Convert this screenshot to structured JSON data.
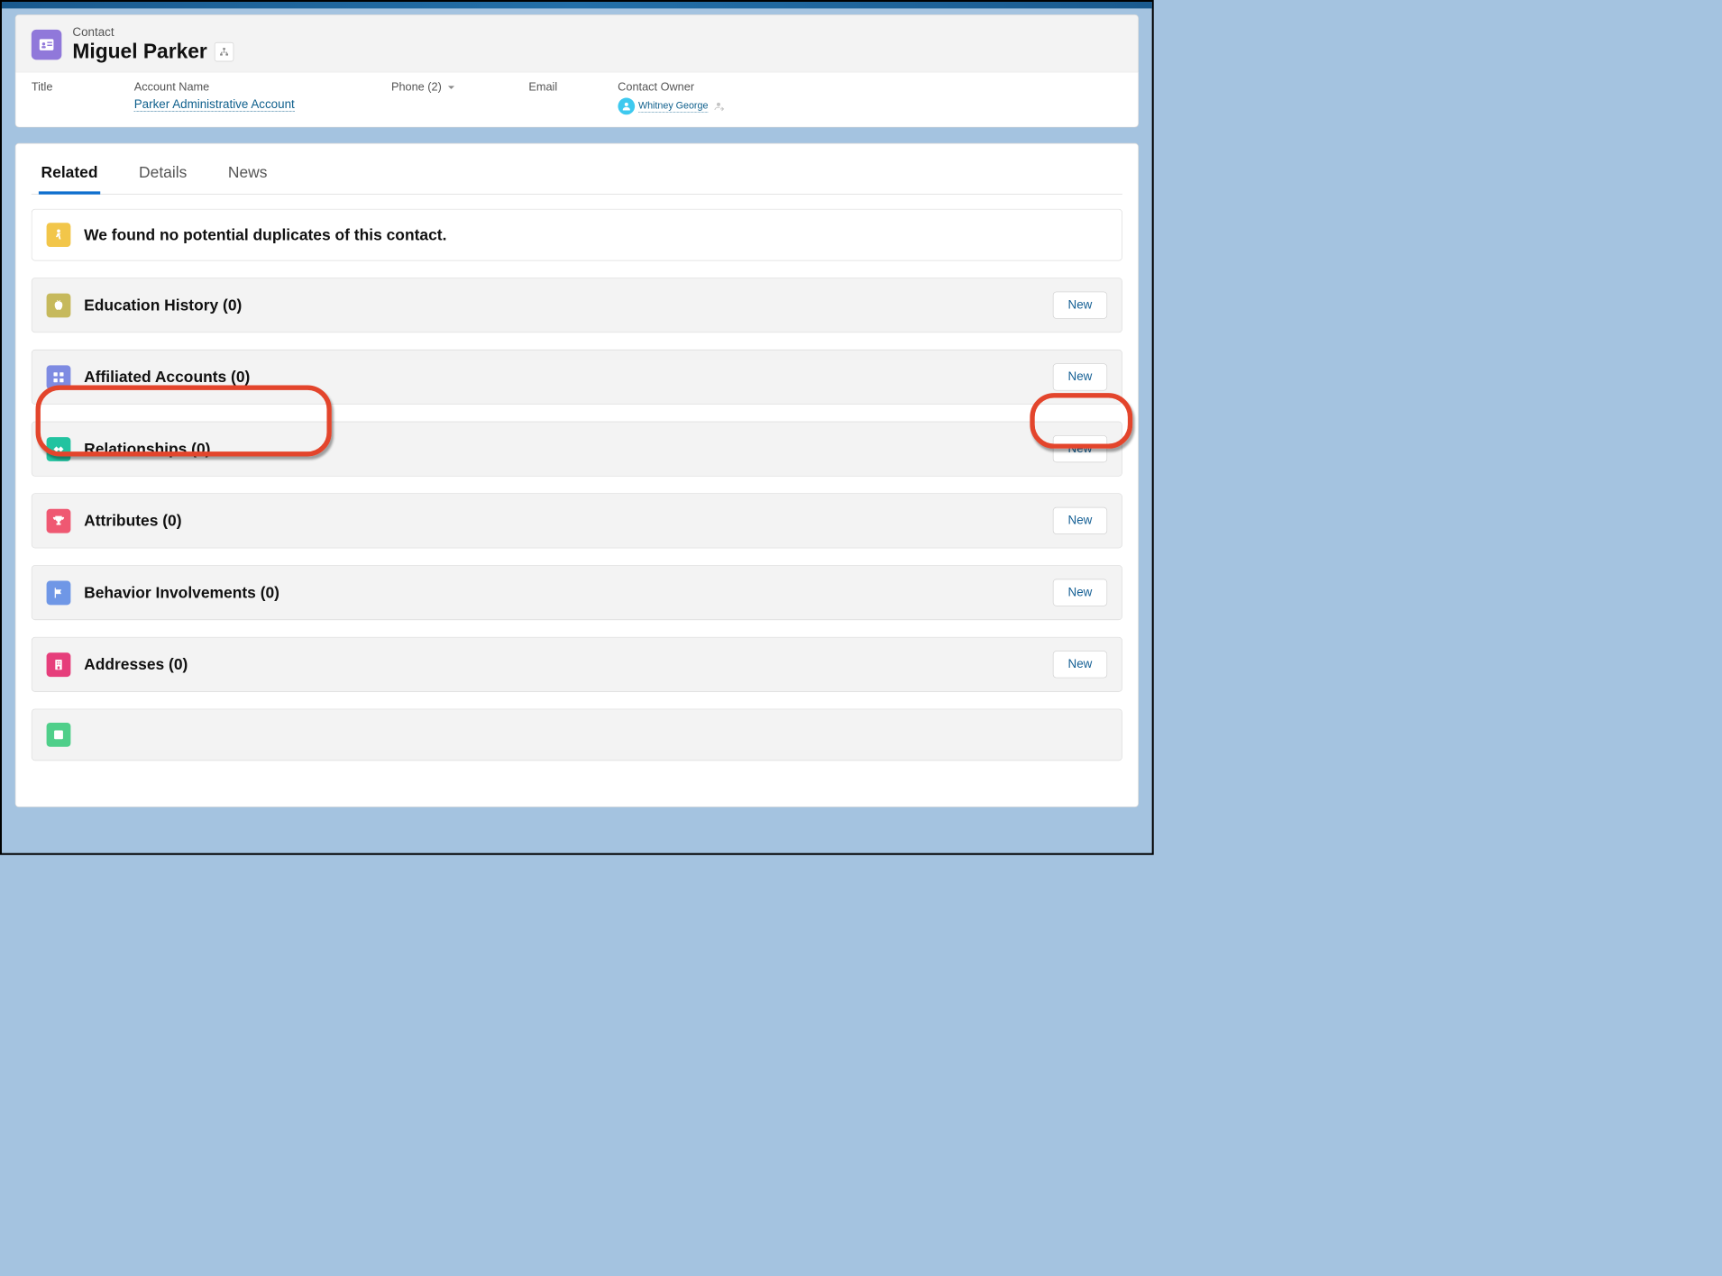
{
  "header": {
    "object_label": "Contact",
    "contact_name": "Miguel Parker"
  },
  "fields": {
    "title_label": "Title",
    "account_label": "Account Name",
    "account_value": "Parker Administrative Account",
    "phone_label": "Phone (2)",
    "email_label": "Email",
    "owner_label": "Contact Owner",
    "owner_value": "Whitney George"
  },
  "tabs": {
    "related": "Related",
    "details": "Details",
    "news": "News"
  },
  "duplicates_msg": "We found no potential duplicates of this contact.",
  "new_label": "New",
  "related_rows": {
    "education": "Education History (0)",
    "affiliated": "Affiliated Accounts (0)",
    "relationships": "Relationships (0)",
    "attributes": "Attributes (0)",
    "behavior": "Behavior Involvements (0)",
    "addresses": "Addresses (0)"
  }
}
